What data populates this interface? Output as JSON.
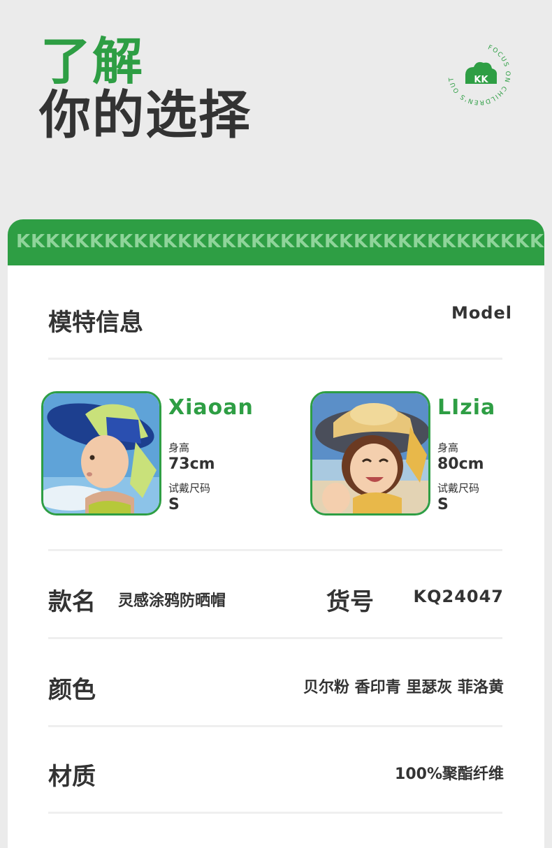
{
  "hero": {
    "line1": "了解",
    "line2": "你的选择"
  },
  "logo": {
    "mark": "KK",
    "ring_text": "FOCUS ON CHILDREN'S OUTDOORS",
    "color": "#2e9e44",
    "icon": "kk-brand-logo"
  },
  "banner": {
    "pattern_glyph": "K",
    "color": "#2e9e44",
    "glyph_color": "#8fd49a"
  },
  "model_section": {
    "title": "模特信息",
    "title_en": "Model"
  },
  "models": [
    {
      "name": "Xiaoan",
      "height_label": "身高",
      "height_value": "73cm",
      "size_label": "试戴尺码",
      "size_value": "S"
    },
    {
      "name": "LIzia",
      "height_label": "身高",
      "height_value": "80cm",
      "size_label": "试戴尺码",
      "size_value": "S"
    }
  ],
  "product": {
    "name_label": "款名",
    "name_value": "灵感涂鸦防晒帽",
    "sku_label": "货号",
    "sku_value": "KQ24047",
    "color_label": "颜色",
    "color_value": "贝尔粉 香印青 里瑟灰 菲洛黄",
    "material_label": "材质",
    "material_value": "100%聚酯纤维"
  }
}
